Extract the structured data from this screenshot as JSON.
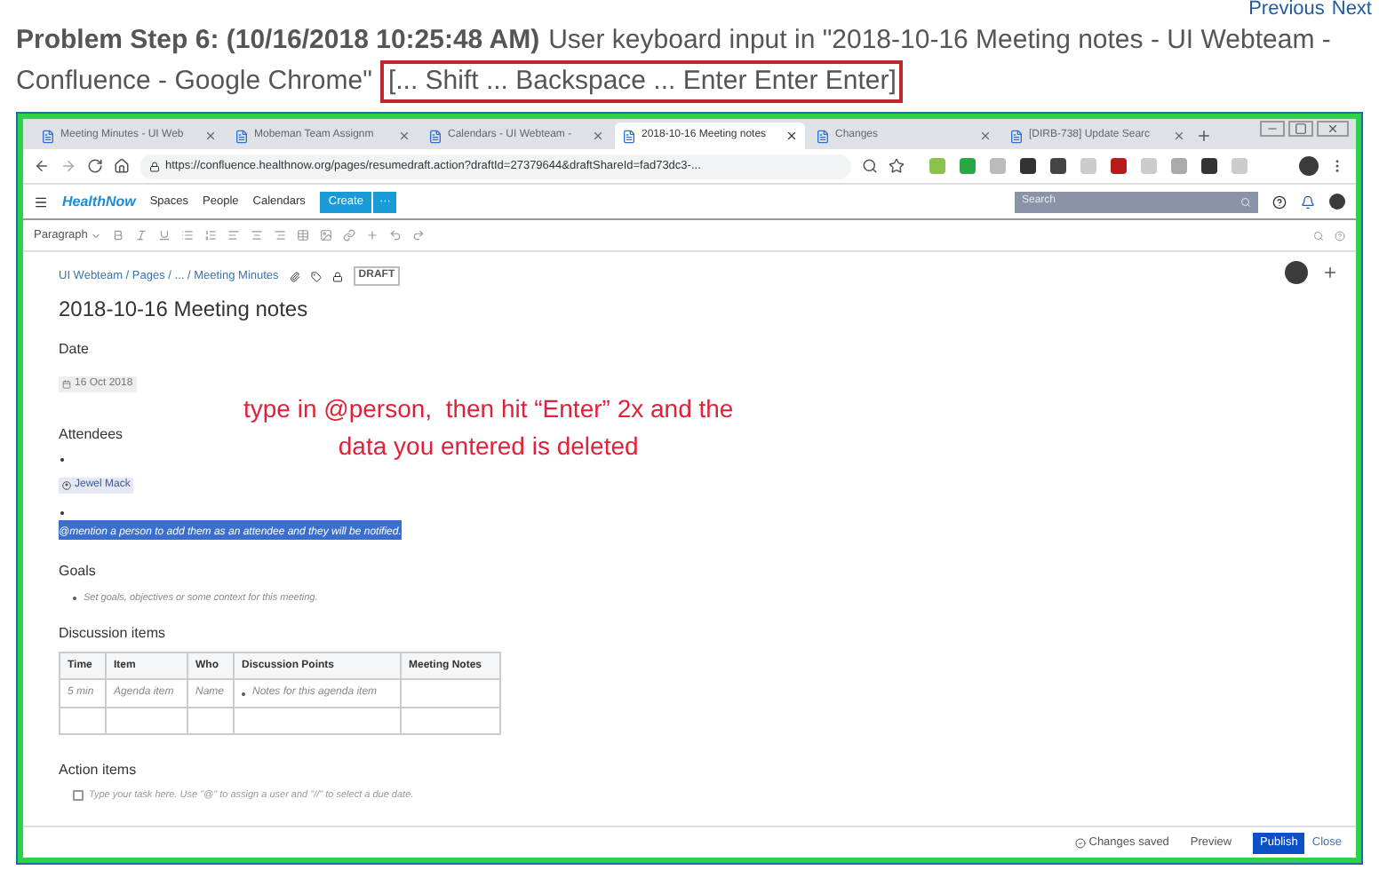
{
  "nav_links": [
    {
      "label": "Previous"
    },
    {
      "label": "Next"
    }
  ],
  "step": {
    "heading": "Problem Step 6: (10/16/2018 10:25:48 AM)",
    "description_lines": [
      "User keyboard input in \"2018-10-16 Meeting notes - UI Webteam -",
      "Confluence - Google Chrome\""
    ],
    "keys": "[... Shift ... Backspace ... Enter Enter Enter]"
  },
  "browser": {
    "tabs": [
      {
        "label": "Meeting Minutes - UI Web",
        "selected": false
      },
      {
        "label": "Mobeman Team Assignm",
        "selected": false
      },
      {
        "label": "Calendars - UI Webteam -",
        "selected": false
      },
      {
        "label": "2018-10-16 Meeting notes",
        "selected": true
      },
      {
        "label": "Changes",
        "selected": false
      },
      {
        "label": "[DIRB-738] Update Searc",
        "selected": false
      }
    ],
    "url": "https://confluence.healthnow.org/pages/resumedraft.action?draftId=27379644&draftShareId=fad73dc3-..."
  },
  "confluence_header": {
    "logo": "HealthNow",
    "nav": [
      "Spaces",
      "People",
      "Calendars"
    ],
    "create": "Create",
    "more": "···",
    "search": {
      "placeholder": "Search"
    }
  },
  "editor_toolbar": {
    "style": "Paragraph"
  },
  "page": {
    "breadcrumb": "UI Webteam / Pages / ... / Meeting Minutes",
    "status": "DRAFT",
    "title": "2018-10-16 Meeting notes",
    "date_label": "Date",
    "date": "16 Oct 2018",
    "attendees_label": "Attendees",
    "mention": "Jewel Mack",
    "selected_placeholder": "@mention a person to add them as an attendee and they will be notified.",
    "goals_label": "Goals",
    "goals": [
      "Set goals, objectives or some context for this meeting."
    ],
    "discussion_label": "Discussion items",
    "table": {
      "columns": [
        "Time",
        "Item",
        "Who",
        "Discussion Points",
        "Meeting Notes"
      ],
      "rows": [
        {
          "time": "5 min",
          "item": "Agenda item",
          "who": "Name",
          "points": [
            "Notes for this agenda item"
          ]
        }
      ]
    },
    "action_label": "Action items",
    "action_items": [
      {
        "text": "Type your task here. Use \"@\" to assign a user and \"//\" to select a due date.",
        "checked": false
      }
    ]
  },
  "annotation": [
    "type in @person,  then hit “Enter” 2x and the",
    "data you entered is deleted"
  ],
  "footer": {
    "status": "Changes saved",
    "preview": "Preview",
    "publish": "Publish",
    "close": "Close"
  }
}
